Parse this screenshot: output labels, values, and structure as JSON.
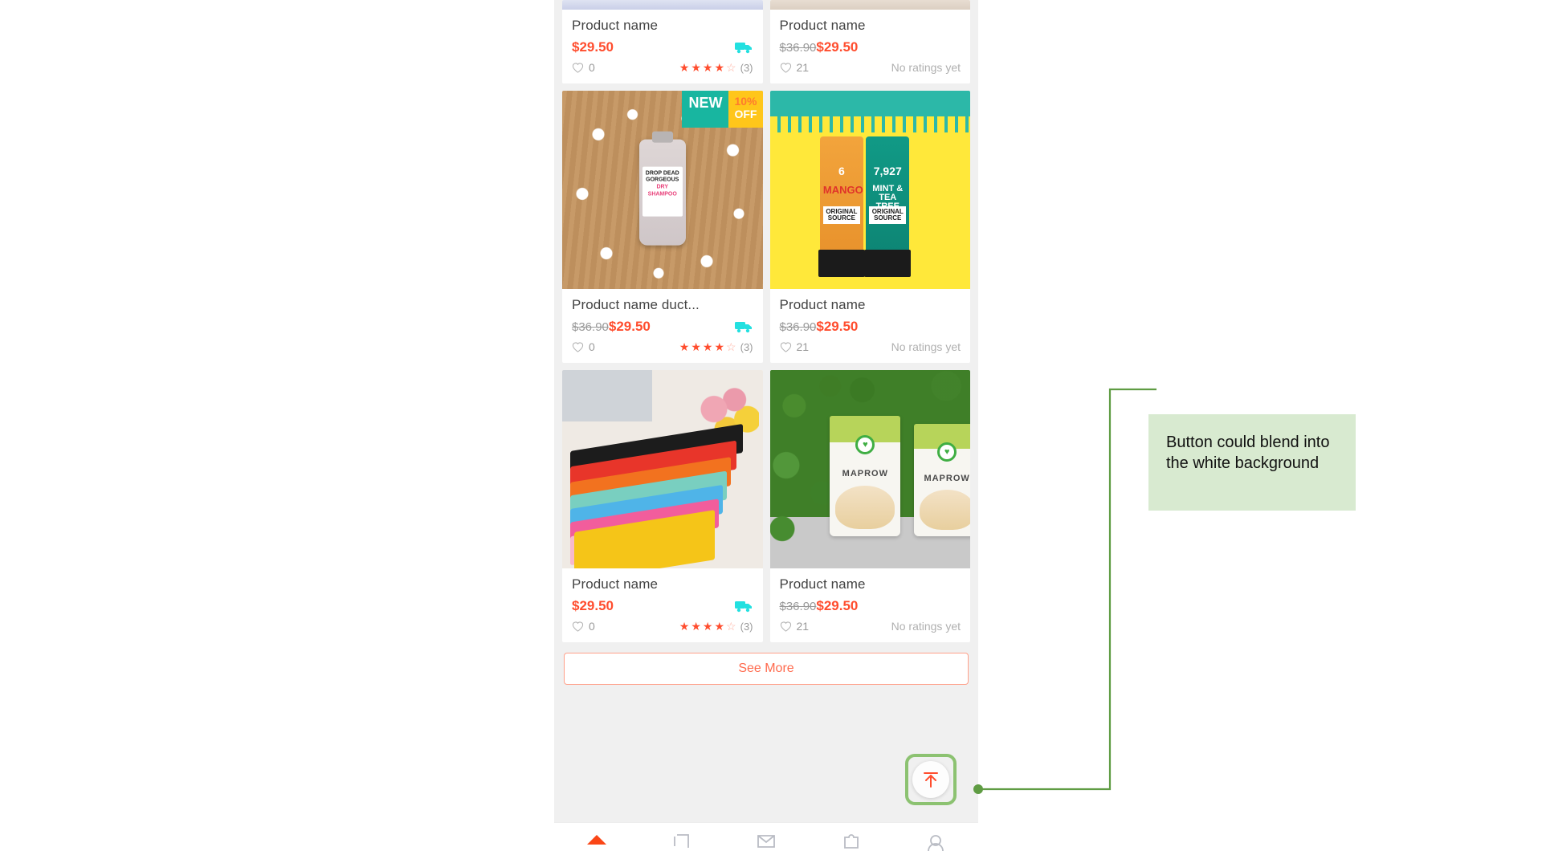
{
  "annotation": {
    "text": "Button could blend into the white background",
    "box_color": "#d8ead0",
    "line_color": "#5f9c43"
  },
  "phone": {
    "background": "#f0f0f0",
    "accent": "#ff4d2e"
  },
  "products": [
    {
      "name": "Product name",
      "old_price": "",
      "price": "$29.50",
      "likes": "0",
      "rating_stars": 4,
      "rating_count": "(3)",
      "no_ratings_text": "",
      "has_truck": true,
      "badges": [],
      "image": "partial-top",
      "partial": true
    },
    {
      "name": "Product name",
      "old_price": "$36.90",
      "price": "$29.50",
      "likes": "21",
      "rating_stars": 0,
      "rating_count": "",
      "no_ratings_text": "No ratings yet",
      "has_truck": false,
      "badges": [],
      "image": "partial-top",
      "partial": true
    },
    {
      "name": "Product name duct...",
      "old_price": "$36.90",
      "price": "$29.50",
      "likes": "0",
      "rating_stars": 4,
      "rating_count": "(3)",
      "no_ratings_text": "",
      "has_truck": true,
      "badges": [
        {
          "label": "NEW",
          "type": "new"
        },
        {
          "label_pct": "10%",
          "label_off": "OFF",
          "type": "discount"
        }
      ],
      "image": "dry-shampoo-flowers",
      "partial": false
    },
    {
      "name": "Product name",
      "old_price": "$36.90",
      "price": "$29.50",
      "likes": "21",
      "rating_stars": 0,
      "rating_count": "",
      "no_ratings_text": "No ratings yet",
      "has_truck": false,
      "badges": [],
      "image": "shower-gel-bottles",
      "partial": false
    },
    {
      "name": "Product name",
      "old_price": "",
      "price": "$29.50",
      "likes": "0",
      "rating_stars": 4,
      "rating_count": "(3)",
      "no_ratings_text": "",
      "has_truck": true,
      "badges": [],
      "image": "colorful-wallets",
      "partial": false
    },
    {
      "name": "Product name",
      "old_price": "$36.90",
      "price": "$29.50",
      "likes": "21",
      "rating_stars": 0,
      "rating_count": "",
      "no_ratings_text": "No ratings yet",
      "has_truck": false,
      "badges": [],
      "image": "coconut-chips-pouches",
      "partial": false
    }
  ],
  "image_text": {
    "shampoo_line1": "DROP DEAD",
    "shampoo_line2": "GORGEOUS",
    "shampoo_line3": "DRY SHAMPOO",
    "gel_left_num": "6",
    "gel_left_name": "MANGO",
    "gel_left_brand": "ORIGINAL SOURCE",
    "gel_right_num": "7,927",
    "gel_right_name": "MINT & TEA TREE",
    "gel_right_brand": "ORIGINAL SOURCE",
    "pouch_brand": "MAPROW"
  },
  "see_more": {
    "label": "See More",
    "border_color": "#ffa08a",
    "text_color": "#ff6a4d"
  },
  "scroll_top": {
    "icon": "scroll-to-top-icon",
    "color": "#ff4d2e"
  },
  "bottom_nav": [
    {
      "icon": "home-icon",
      "active": true
    },
    {
      "icon": "categories-icon",
      "active": false
    },
    {
      "icon": "messages-icon",
      "active": false
    },
    {
      "icon": "cart-icon",
      "active": false
    },
    {
      "icon": "profile-icon",
      "active": false
    }
  ]
}
